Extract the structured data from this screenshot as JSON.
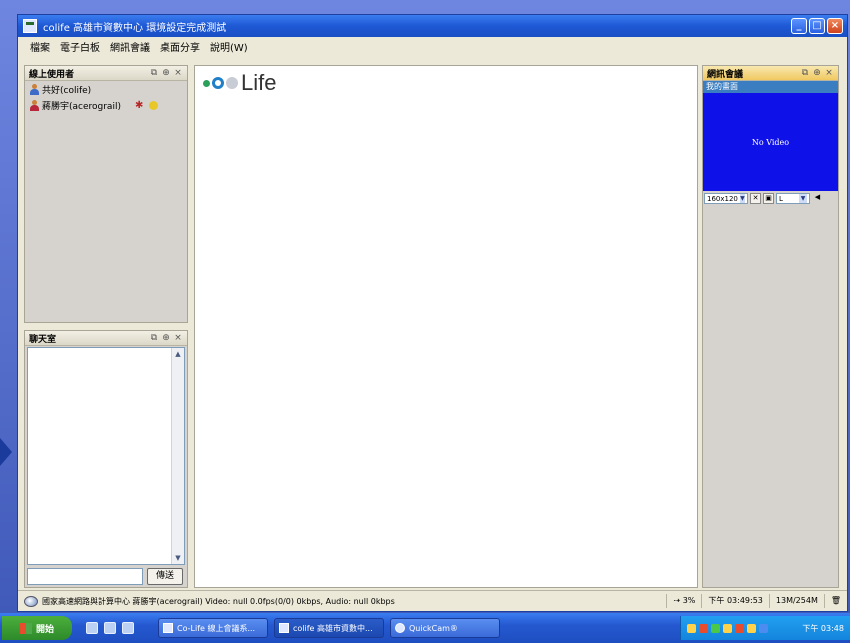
{
  "window": {
    "title": "colife 高雄市資數中心 環境設定完成測試",
    "controls": [
      "minimize",
      "maximize",
      "close"
    ]
  },
  "menu": [
    "檔案",
    "電子白板",
    "網訊會議",
    "桌面分享",
    "說明(W)"
  ],
  "online_users": {
    "title": "線上使用者",
    "users": [
      {
        "name": "共好(colife)",
        "role": "user"
      },
      {
        "name": "蔣勝宇(acerograil)",
        "role": "speaker"
      }
    ]
  },
  "chat": {
    "title": "聊天室",
    "input_value": "",
    "send_label": "傳送"
  },
  "whiteboard": {
    "logo_text": "Life"
  },
  "video": {
    "title": "網訊會議",
    "subtitle": "我的畫面",
    "placeholder": "No Video",
    "resolution": "160x120",
    "quality": "L"
  },
  "status": {
    "message": "國家高速網路與計算中心 蔣勝宇(acerograil) Video: null 0.0fps(0/0) 0kbps, Audio: null 0kbps",
    "cpu": "3%",
    "time": "下午 03:49:53",
    "memory": "13M/254M"
  },
  "taskbar": {
    "start_label": "開始",
    "buttons": [
      "Co-Life 線上會議系...",
      "colife 高雄市資數中...",
      "QuickCam®"
    ],
    "clock": "下午 03:48"
  }
}
